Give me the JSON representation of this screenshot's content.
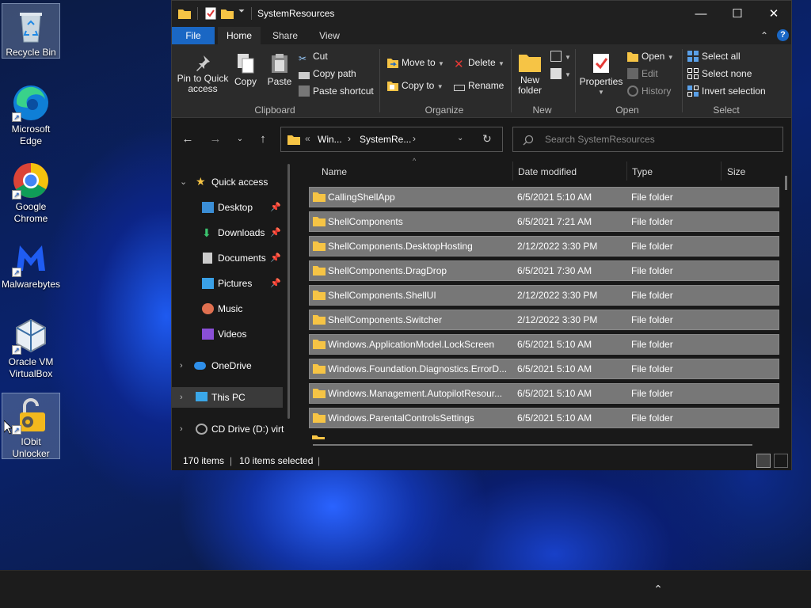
{
  "desktop": {
    "icons": [
      {
        "label": "Recycle Bin"
      },
      {
        "label": "Microsoft Edge"
      },
      {
        "label": "Google Chrome"
      },
      {
        "label": "Malwarebytes"
      },
      {
        "label": "Oracle VM VirtualBox"
      },
      {
        "label": "IObit Unlocker"
      }
    ]
  },
  "window": {
    "title": "SystemResources",
    "controls": {
      "minimize": "—",
      "maximize": "☐",
      "close": "✕"
    }
  },
  "ribbon_tabs": {
    "file": "File",
    "home": "Home",
    "share": "Share",
    "view": "View"
  },
  "ribbon": {
    "clipboard": {
      "pin": "Pin to Quick access",
      "copy": "Copy",
      "paste": "Paste",
      "cut": "Cut",
      "copy_path": "Copy path",
      "paste_shortcut": "Paste shortcut",
      "label": "Clipboard"
    },
    "organize": {
      "move_to": "Move to",
      "copy_to": "Copy to",
      "delete": "Delete",
      "rename": "Rename",
      "label": "Organize"
    },
    "new": {
      "new_folder": "New folder",
      "label": "New"
    },
    "open": {
      "properties": "Properties",
      "open": "Open",
      "edit": "Edit",
      "history": "History",
      "label": "Open"
    },
    "select": {
      "select_all": "Select all",
      "select_none": "Select none",
      "invert": "Invert selection",
      "label": "Select"
    }
  },
  "address": {
    "prefix": "«",
    "crumb1": "Win...",
    "crumb2": "SystemRe...",
    "search_placeholder": "Search SystemResources"
  },
  "nav": {
    "quick_access": "Quick access",
    "desktop": "Desktop",
    "downloads": "Downloads",
    "documents": "Documents",
    "pictures": "Pictures",
    "music": "Music",
    "videos": "Videos",
    "onedrive": "OneDrive",
    "this_pc": "This PC",
    "cd_drive": "CD Drive (D:) virt"
  },
  "columns": {
    "name": "Name",
    "date": "Date modified",
    "type": "Type",
    "size": "Size"
  },
  "files": [
    {
      "name": "CallingShellApp",
      "date": "6/5/2021 5:10 AM",
      "type": "File folder"
    },
    {
      "name": "ShellComponents",
      "date": "6/5/2021 7:21 AM",
      "type": "File folder"
    },
    {
      "name": "ShellComponents.DesktopHosting",
      "date": "2/12/2022 3:30 PM",
      "type": "File folder"
    },
    {
      "name": "ShellComponents.DragDrop",
      "date": "6/5/2021 7:30 AM",
      "type": "File folder"
    },
    {
      "name": "ShellComponents.ShellUI",
      "date": "2/12/2022 3:30 PM",
      "type": "File folder"
    },
    {
      "name": "ShellComponents.Switcher",
      "date": "2/12/2022 3:30 PM",
      "type": "File folder"
    },
    {
      "name": "Windows.ApplicationModel.LockScreen",
      "date": "6/5/2021 5:10 AM",
      "type": "File folder"
    },
    {
      "name": "Windows.Foundation.Diagnostics.ErrorD...",
      "date": "6/5/2021 5:10 AM",
      "type": "File folder"
    },
    {
      "name": "Windows.Management.AutopilotResour...",
      "date": "6/5/2021 5:10 AM",
      "type": "File folder"
    },
    {
      "name": "Windows.ParentalControlsSettings",
      "date": "6/5/2021 5:10 AM",
      "type": "File folder"
    }
  ],
  "status": {
    "item_count": "170 items",
    "selected": "10 items selected"
  },
  "colors": {
    "accent": "#1a67c4",
    "folder": "#f6c445",
    "selection_row": "#777777"
  }
}
